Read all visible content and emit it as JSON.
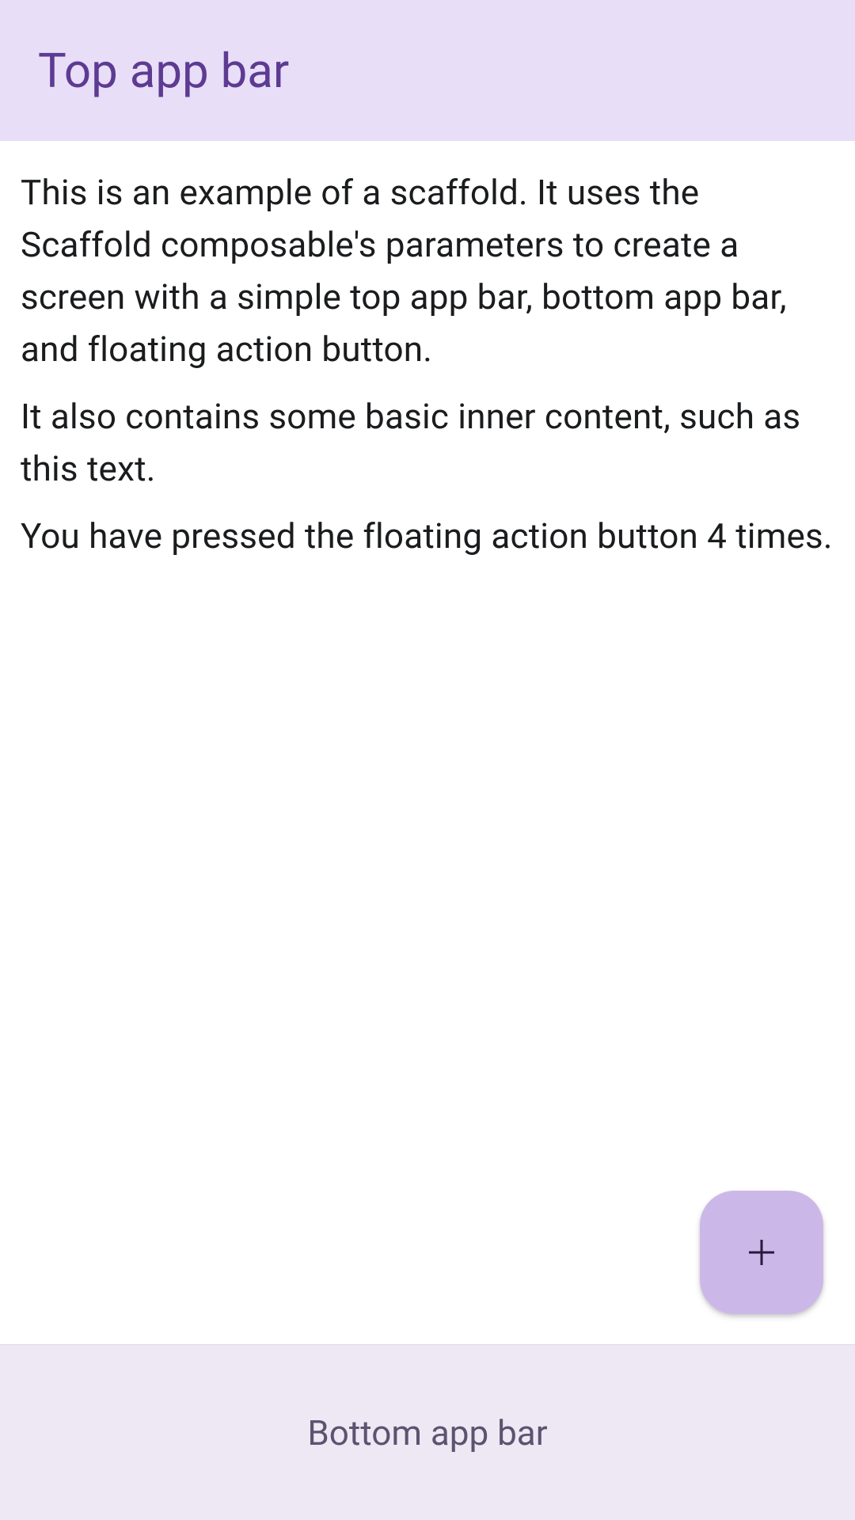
{
  "topBar": {
    "title": "Top app bar"
  },
  "content": {
    "paragraph1": "This is an example of a scaffold. It uses the Scaffold composable's parameters to create a screen with a simple top app bar, bottom app bar, and floating action button.",
    "paragraph2": "It also contains some basic inner content, such as this text.",
    "pressCountPrefix": "You have pressed the floating action button ",
    "pressCount": 4,
    "pressCountSuffix": " times."
  },
  "bottomBar": {
    "label": "Bottom app bar"
  },
  "fab": {
    "iconName": "add"
  }
}
